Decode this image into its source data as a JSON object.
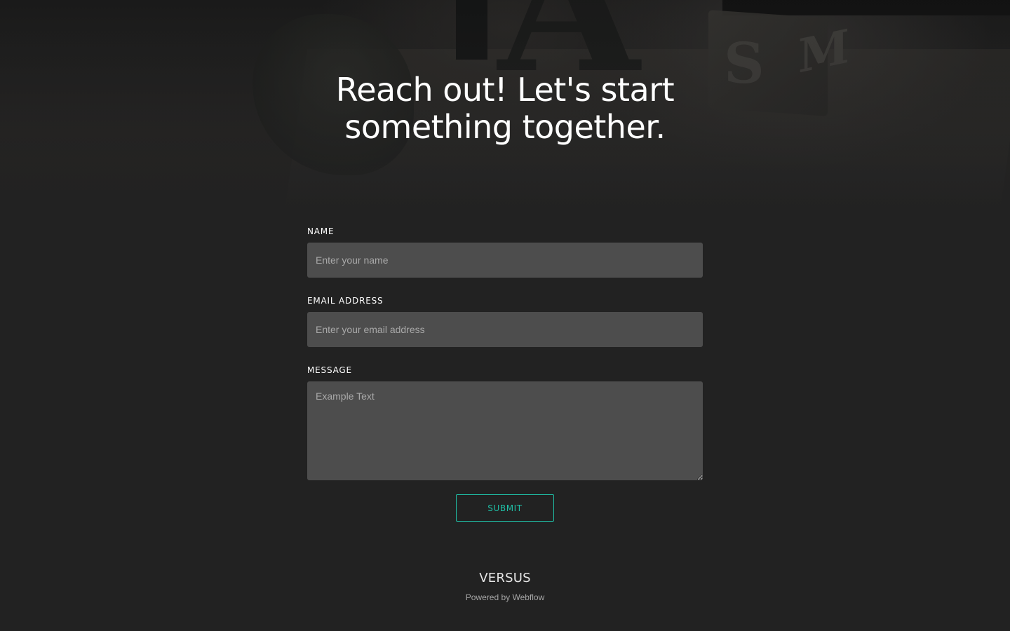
{
  "hero": {
    "headline": "Reach out! Let's start something together."
  },
  "form": {
    "name": {
      "label": "NAME",
      "placeholder": "Enter your name"
    },
    "email": {
      "label": "EMAIL ADDRESS",
      "placeholder": "Enter your email address"
    },
    "message": {
      "label": "MESSAGE",
      "placeholder": "Example Text"
    },
    "submit_label": "SUBMIT"
  },
  "footer": {
    "brand": "VERSUS",
    "powered_by": "Powered by Webflow"
  },
  "colors": {
    "background": "#222222",
    "input_background": "#4d4d4d",
    "accent": "#1fbfa6",
    "text": "#ffffff"
  }
}
